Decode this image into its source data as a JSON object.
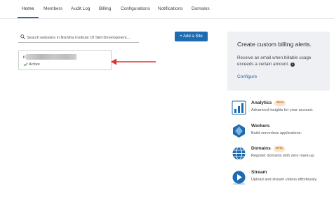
{
  "nav": {
    "tabs": [
      {
        "label": "Home",
        "active": true
      },
      {
        "label": "Members",
        "active": false
      },
      {
        "label": "Audit Log",
        "active": false
      },
      {
        "label": "Billing",
        "active": false
      },
      {
        "label": "Configurations",
        "active": false
      },
      {
        "label": "Notifications",
        "active": false
      },
      {
        "label": "Domains",
        "active": false
      }
    ],
    "accent_color": "#1c6fc4"
  },
  "search": {
    "placeholder": "Search websites in Nishtha Institute Of Skill Development...",
    "value": "",
    "icon": "search-icon"
  },
  "add_site": {
    "label": "+ Add a Site"
  },
  "site_card": {
    "name": "n",
    "status": "Active",
    "status_icon": "checkmark-icon"
  },
  "annotation": {
    "arrow_color": "#e0302c"
  },
  "billing_alerts": {
    "title": "Create custom billing alerts.",
    "description": "Receive an email when billable usage exceeds a certain amount.",
    "link": "Configure"
  },
  "products": [
    {
      "name": "Analytics",
      "badge": "Beta",
      "description": "Advanced insights for your account.",
      "icon": "analytics-icon"
    },
    {
      "name": "Workers",
      "badge": "",
      "description": "Build serverless applications.",
      "icon": "workers-icon"
    },
    {
      "name": "Domains",
      "badge": "Beta",
      "description": "Register domains with zero mark-up.",
      "icon": "domains-icon"
    },
    {
      "name": "Stream",
      "badge": "",
      "description": "Upload and stream videos effortlessly.",
      "icon": "stream-icon"
    }
  ]
}
